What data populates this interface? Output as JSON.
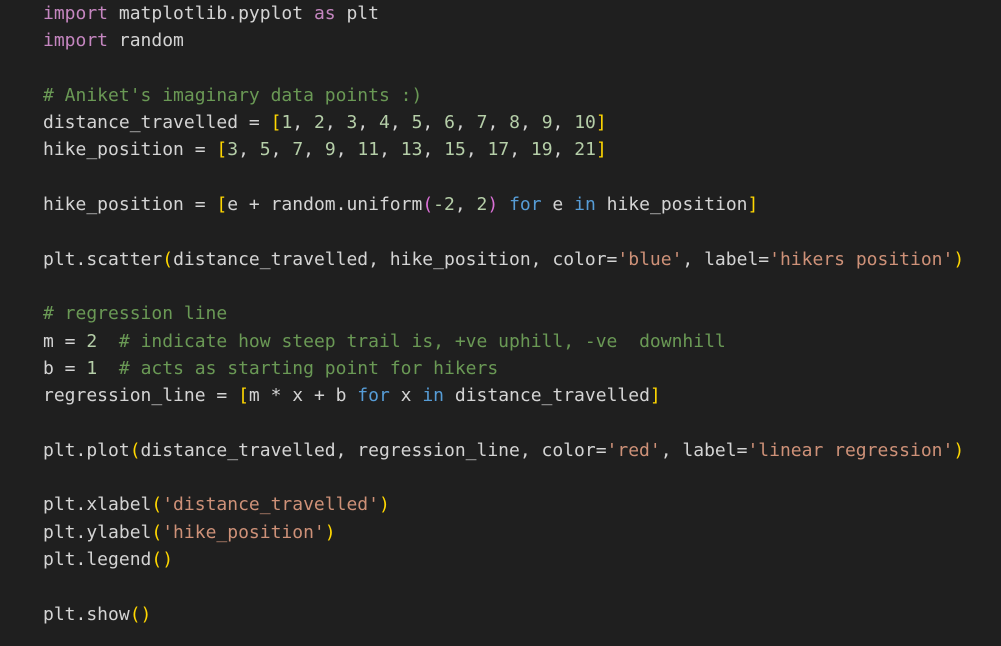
{
  "editor": {
    "background": "#1f1f1f",
    "lines": [
      [
        {
          "t": "import",
          "c": "kw2"
        },
        {
          "t": " matplotlib.pyplot ",
          "c": "txt"
        },
        {
          "t": "as",
          "c": "kw2"
        },
        {
          "t": " plt",
          "c": "txt"
        }
      ],
      [
        {
          "t": "import",
          "c": "kw2"
        },
        {
          "t": " random",
          "c": "txt"
        }
      ],
      [],
      [
        {
          "t": "# Aniket's imaginary data points :)",
          "c": "cmt"
        }
      ],
      [
        {
          "t": "distance_travelled",
          "c": "txt"
        },
        {
          "t": " = ",
          "c": "op"
        },
        {
          "t": "[",
          "c": "b1"
        },
        {
          "t": "1",
          "c": "num"
        },
        {
          "t": ", ",
          "c": "op"
        },
        {
          "t": "2",
          "c": "num"
        },
        {
          "t": ", ",
          "c": "op"
        },
        {
          "t": "3",
          "c": "num"
        },
        {
          "t": ", ",
          "c": "op"
        },
        {
          "t": "4",
          "c": "num"
        },
        {
          "t": ", ",
          "c": "op"
        },
        {
          "t": "5",
          "c": "num"
        },
        {
          "t": ", ",
          "c": "op"
        },
        {
          "t": "6",
          "c": "num"
        },
        {
          "t": ", ",
          "c": "op"
        },
        {
          "t": "7",
          "c": "num"
        },
        {
          "t": ", ",
          "c": "op"
        },
        {
          "t": "8",
          "c": "num"
        },
        {
          "t": ", ",
          "c": "op"
        },
        {
          "t": "9",
          "c": "num"
        },
        {
          "t": ", ",
          "c": "op"
        },
        {
          "t": "10",
          "c": "num"
        },
        {
          "t": "]",
          "c": "b1"
        }
      ],
      [
        {
          "t": "hike_position",
          "c": "txt"
        },
        {
          "t": " = ",
          "c": "op"
        },
        {
          "t": "[",
          "c": "b1"
        },
        {
          "t": "3",
          "c": "num"
        },
        {
          "t": ", ",
          "c": "op"
        },
        {
          "t": "5",
          "c": "num"
        },
        {
          "t": ", ",
          "c": "op"
        },
        {
          "t": "7",
          "c": "num"
        },
        {
          "t": ", ",
          "c": "op"
        },
        {
          "t": "9",
          "c": "num"
        },
        {
          "t": ", ",
          "c": "op"
        },
        {
          "t": "11",
          "c": "num"
        },
        {
          "t": ", ",
          "c": "op"
        },
        {
          "t": "13",
          "c": "num"
        },
        {
          "t": ", ",
          "c": "op"
        },
        {
          "t": "15",
          "c": "num"
        },
        {
          "t": ", ",
          "c": "op"
        },
        {
          "t": "17",
          "c": "num"
        },
        {
          "t": ", ",
          "c": "op"
        },
        {
          "t": "19",
          "c": "num"
        },
        {
          "t": ", ",
          "c": "op"
        },
        {
          "t": "21",
          "c": "num"
        },
        {
          "t": "]",
          "c": "b1"
        }
      ],
      [],
      [
        {
          "t": "hike_position",
          "c": "txt"
        },
        {
          "t": " = ",
          "c": "op"
        },
        {
          "t": "[",
          "c": "b1"
        },
        {
          "t": "e + random.uniform",
          "c": "txt"
        },
        {
          "t": "(",
          "c": "b2"
        },
        {
          "t": "-2",
          "c": "num"
        },
        {
          "t": ", ",
          "c": "op"
        },
        {
          "t": "2",
          "c": "num"
        },
        {
          "t": ")",
          "c": "b2"
        },
        {
          "t": " ",
          "c": "txt"
        },
        {
          "t": "for",
          "c": "kw"
        },
        {
          "t": " e ",
          "c": "txt"
        },
        {
          "t": "in",
          "c": "kw"
        },
        {
          "t": " hike_position",
          "c": "txt"
        },
        {
          "t": "]",
          "c": "b1"
        }
      ],
      [],
      [
        {
          "t": "plt.scatter",
          "c": "txt"
        },
        {
          "t": "(",
          "c": "b1"
        },
        {
          "t": "distance_travelled, hike_position, color=",
          "c": "txt"
        },
        {
          "t": "'blue'",
          "c": "str"
        },
        {
          "t": ", label=",
          "c": "txt"
        },
        {
          "t": "'hikers position'",
          "c": "str"
        },
        {
          "t": ")",
          "c": "b1"
        }
      ],
      [],
      [
        {
          "t": "# regression line",
          "c": "cmt"
        }
      ],
      [
        {
          "t": "m",
          "c": "txt"
        },
        {
          "t": " = ",
          "c": "op"
        },
        {
          "t": "2",
          "c": "num"
        },
        {
          "t": "  ",
          "c": "txt"
        },
        {
          "t": "# indicate how steep trail is, +ve uphill, -ve  downhill",
          "c": "cmt"
        }
      ],
      [
        {
          "t": "b",
          "c": "txt"
        },
        {
          "t": " = ",
          "c": "op"
        },
        {
          "t": "1",
          "c": "num"
        },
        {
          "t": "  ",
          "c": "txt"
        },
        {
          "t": "# acts as starting point for hikers",
          "c": "cmt"
        }
      ],
      [
        {
          "t": "regression_line",
          "c": "txt"
        },
        {
          "t": " = ",
          "c": "op"
        },
        {
          "t": "[",
          "c": "b1"
        },
        {
          "t": "m * x + b ",
          "c": "txt"
        },
        {
          "t": "for",
          "c": "kw"
        },
        {
          "t": " x ",
          "c": "txt"
        },
        {
          "t": "in",
          "c": "kw"
        },
        {
          "t": " distance_travelled",
          "c": "txt"
        },
        {
          "t": "]",
          "c": "b1"
        }
      ],
      [],
      [
        {
          "t": "plt.plot",
          "c": "txt"
        },
        {
          "t": "(",
          "c": "b1"
        },
        {
          "t": "distance_travelled, regression_line, color=",
          "c": "txt"
        },
        {
          "t": "'red'",
          "c": "str"
        },
        {
          "t": ", label=",
          "c": "txt"
        },
        {
          "t": "'linear regression'",
          "c": "str"
        },
        {
          "t": ")",
          "c": "b1"
        }
      ],
      [],
      [
        {
          "t": "plt.xlabel",
          "c": "txt"
        },
        {
          "t": "(",
          "c": "b1"
        },
        {
          "t": "'distance_travelled'",
          "c": "str"
        },
        {
          "t": ")",
          "c": "b1"
        }
      ],
      [
        {
          "t": "plt.ylabel",
          "c": "txt"
        },
        {
          "t": "(",
          "c": "b1"
        },
        {
          "t": "'hike_position'",
          "c": "str"
        },
        {
          "t": ")",
          "c": "b1"
        }
      ],
      [
        {
          "t": "plt.legend",
          "c": "txt"
        },
        {
          "t": "()",
          "c": "b1"
        }
      ],
      [],
      [
        {
          "t": "plt.show",
          "c": "txt"
        },
        {
          "t": "()",
          "c": "b1"
        }
      ]
    ]
  }
}
